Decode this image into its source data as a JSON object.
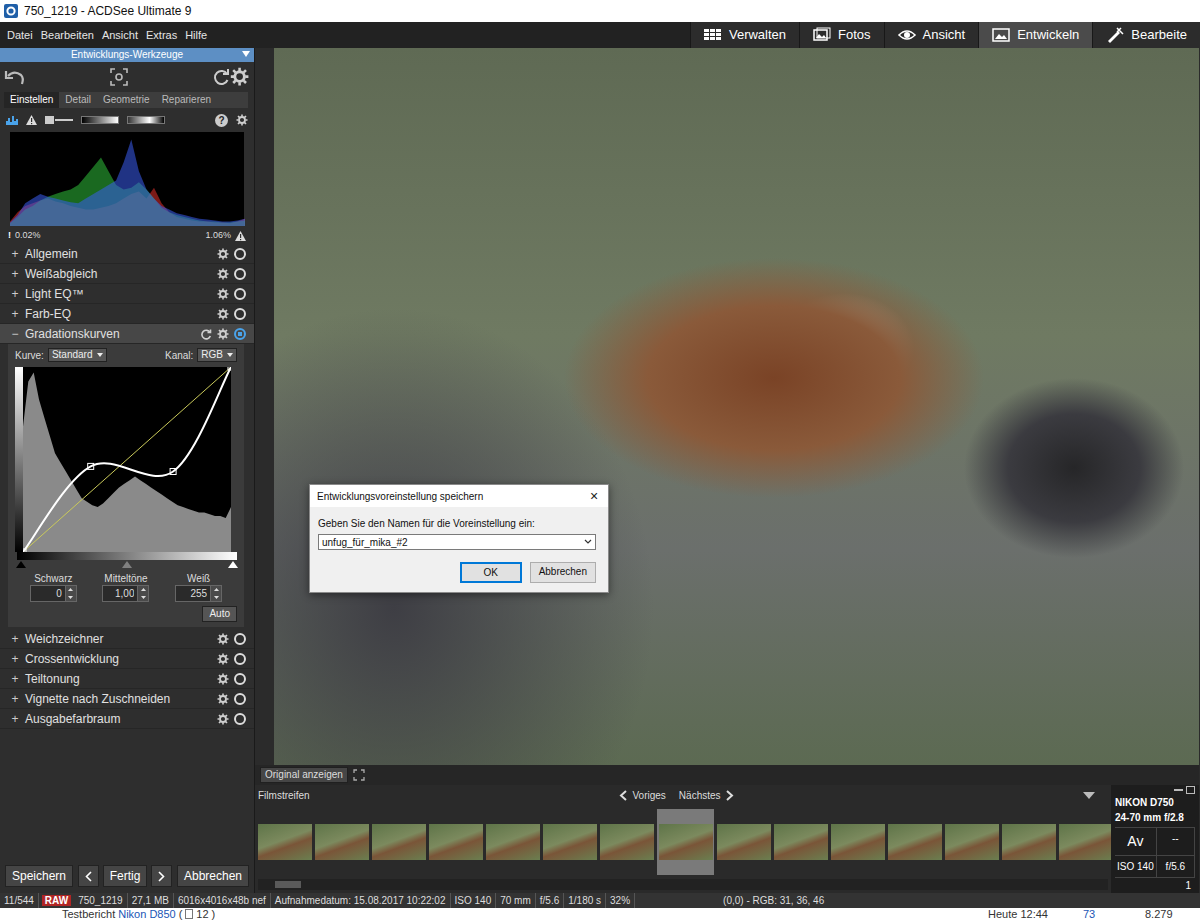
{
  "window": {
    "title": "750_1219 - ACDSee Ultimate 9"
  },
  "menu": [
    "Datei",
    "Bearbeiten",
    "Ansicht",
    "Extras",
    "Hilfe"
  ],
  "modes": [
    {
      "label": "Verwalten",
      "selected": false
    },
    {
      "label": "Fotos",
      "selected": false
    },
    {
      "label": "Ansicht",
      "selected": false
    },
    {
      "label": "Entwickeln",
      "selected": true
    },
    {
      "label": "Bearbeite",
      "selected": false
    }
  ],
  "panel": {
    "title": "Entwicklungs-Werkzeuge",
    "tabs": [
      {
        "label": "Einstellen",
        "selected": true
      },
      {
        "label": "Detail",
        "selected": false
      },
      {
        "label": "Geometrie",
        "selected": false
      },
      {
        "label": "Reparieren",
        "selected": false
      }
    ],
    "help": "?",
    "histogram": {
      "red": [
        5,
        15,
        22,
        25,
        28,
        30,
        27,
        25,
        22,
        20,
        18,
        18,
        20,
        22,
        25,
        30,
        35,
        38,
        30,
        42,
        25,
        15,
        10,
        8,
        6,
        5,
        5,
        4,
        4,
        3,
        5,
        8
      ],
      "green": [
        3,
        10,
        18,
        22,
        28,
        32,
        35,
        38,
        40,
        45,
        55,
        65,
        75,
        60,
        45,
        40,
        42,
        48,
        40,
        30,
        20,
        15,
        12,
        10,
        8,
        6,
        5,
        5,
        4,
        4,
        5,
        6
      ],
      "blue": [
        4,
        12,
        25,
        30,
        35,
        32,
        30,
        28,
        26,
        25,
        30,
        35,
        40,
        45,
        50,
        70,
        95,
        60,
        40,
        30,
        22,
        18,
        14,
        12,
        10,
        8,
        7,
        6,
        5,
        5,
        6,
        8
      ],
      "low_icon": "!",
      "low_clip": "0.02%",
      "high_clip": "1.06%"
    },
    "sections_top": [
      {
        "toggle": "+",
        "label": "Allgemein",
        "expanded": false,
        "enabled": false
      },
      {
        "toggle": "+",
        "label": "Weißabgleich",
        "expanded": false,
        "enabled": false
      },
      {
        "toggle": "+",
        "label": "Light EQ™",
        "expanded": false,
        "enabled": false
      },
      {
        "toggle": "+",
        "label": "Farb-EQ",
        "expanded": false,
        "enabled": false
      }
    ],
    "curves": {
      "toggle": "−",
      "label": "Gradationskurven",
      "expanded": true,
      "enabled": true,
      "curve_label": "Kurve:",
      "curve_value": "Standard",
      "channel_label": "Kanal:",
      "channel_value": "RGB",
      "histogram": [
        70,
        95,
        100,
        85,
        75,
        65,
        55,
        50,
        45,
        40,
        35,
        30,
        28,
        26,
        25,
        27,
        30,
        33,
        36,
        38,
        40,
        42,
        40,
        38,
        36,
        34,
        32,
        30,
        28,
        26,
        25,
        24,
        23,
        22,
        22,
        21,
        20,
        20,
        19,
        25
      ],
      "points": [
        [
          0,
          0
        ],
        [
          83,
          118
        ],
        [
          184,
          111
        ],
        [
          255,
          255
        ]
      ],
      "levels": [
        {
          "label": "Schwarz",
          "value": "0",
          "level": 0
        },
        {
          "label": "Mitteltöne",
          "value": "1,00",
          "level": 0.5
        },
        {
          "label": "Weiß",
          "value": "255",
          "level": 1
        }
      ],
      "auto": "Auto"
    },
    "sections_bottom": [
      {
        "toggle": "+",
        "label": "Weichzeichner",
        "expanded": false,
        "enabled": false
      },
      {
        "toggle": "+",
        "label": "Crossentwicklung",
        "expanded": false,
        "enabled": false
      },
      {
        "toggle": "+",
        "label": "Teiltonung",
        "expanded": false,
        "enabled": false
      },
      {
        "toggle": "+",
        "label": "Vignette nach Zuschneiden",
        "expanded": false,
        "enabled": false
      },
      {
        "toggle": "+",
        "label": "Ausgabefarbraum",
        "expanded": false,
        "enabled": false
      }
    ],
    "footer": {
      "save": "Speichern",
      "done": "Fertig",
      "cancel": "Abbrechen"
    }
  },
  "viewer": {
    "original": "Original anzeigen"
  },
  "dialog": {
    "title": "Entwicklungsvoreinstellung speichern",
    "close": "×",
    "prompt": "Geben Sie den Namen für die Voreinstellung ein:",
    "value": "unfug_für_mika_#2",
    "buttons": [
      {
        "label": "OK",
        "default": true
      },
      {
        "label": "Abbrechen",
        "default": false
      }
    ]
  },
  "filmstrip": {
    "title": "Filmstreifen",
    "prev": "Voriges",
    "next": "Nächstes",
    "thumbs": [
      {
        "selected": false
      },
      {
        "selected": false
      },
      {
        "selected": false
      },
      {
        "selected": false
      },
      {
        "selected": false
      },
      {
        "selected": false
      },
      {
        "selected": false
      },
      {
        "selected": true
      },
      {
        "selected": false
      },
      {
        "selected": false
      },
      {
        "selected": false
      },
      {
        "selected": false
      },
      {
        "selected": false
      },
      {
        "selected": false
      },
      {
        "selected": false
      }
    ],
    "scroll_level": 0.02
  },
  "info": {
    "camera": "NIKON D750",
    "lens": "24-70 mm f/2.8",
    "mode": "Av",
    "exposure": "--",
    "iso": "ISO 140",
    "aperture": "f/5.6",
    "shutter": "1"
  },
  "status_bar": [
    {
      "text": "11/544",
      "kind": "text"
    },
    {
      "text": "RAW",
      "kind": "badge"
    },
    {
      "text": "750_1219",
      "kind": "text"
    },
    {
      "text": "27,1 MB",
      "kind": "text"
    },
    {
      "text": "6016x4016x48b nef",
      "kind": "text"
    },
    {
      "text": "Aufnahmedatum: 15.08.2017 10:22:02",
      "kind": "text"
    },
    {
      "text": "ISO 140",
      "kind": "text"
    },
    {
      "text": "70 mm",
      "kind": "text"
    },
    {
      "text": "f/5.6",
      "kind": "text"
    },
    {
      "text": "1/180 s",
      "kind": "text"
    },
    {
      "text": "32%",
      "kind": "text"
    },
    {
      "text": "(0,0) - RGB: 31, 36, 46",
      "kind": "text"
    }
  ],
  "background_page": {
    "title": "Testbericht",
    "link": "Nikon D850",
    "count_prefix": "(",
    "count": "12",
    "count_suffix": ")",
    "time": "Heute 12:44",
    "replies": "73",
    "views": "8.279"
  }
}
